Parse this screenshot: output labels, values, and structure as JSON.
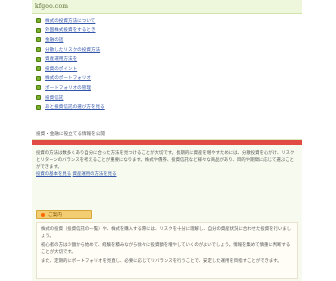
{
  "site": {
    "title": "kfgoo.com"
  },
  "menu": {
    "items": [
      {
        "label": "株式の投資方法について"
      },
      {
        "label": "外国株式投資をするとき"
      },
      {
        "label": "金融の話"
      },
      {
        "label": "分散したリスクの投資方法"
      },
      {
        "label": "資産運用方法を"
      },
      {
        "label": "投資のポイント"
      },
      {
        "label": "株式のポートフォリオ"
      },
      {
        "label": "ポートフォリオの管理"
      },
      {
        "label": "投資信託"
      },
      {
        "label": "あと投資信託の選び方を見る"
      }
    ]
  },
  "notice": "投資・金融に役立てる情報を公開",
  "content": {
    "intro": "投資の方法は数多くあり自分に合った方法を見つけることが大切です。長期的に資産を増やすためには、分散投資を心がけ、リスクとリターンのバランスを考えることが重要になります。株式や債券、投資信託など様々な商品があり、目的や期間に応じて選ぶことができます。",
    "links": [
      "投資の基本を見る",
      "資産運用の方法を見る"
    ],
    "tag_label": "ご案内",
    "panel_p1": "株式の投資（投資信託の一覧）や、株式を購入する際には、リスクを十分に理解し、自分の資産状況に合わせた投資を行いましょう。",
    "panel_p2": "初心者の方は少額から始めて、経験を積みながら徐々に投資額を増やしていくのがよいでしょう。情報を集めて慎重に判断することが大切です。",
    "panel_p3": "また、定期的にポートフォリオを見直し、必要に応じてリバランスを行うことで、安定した運用を目指すことができます。"
  },
  "colors": {
    "accent_green": "#79b22a",
    "red_bar": "#e14b43",
    "tag_bg": "#f3cd72"
  }
}
